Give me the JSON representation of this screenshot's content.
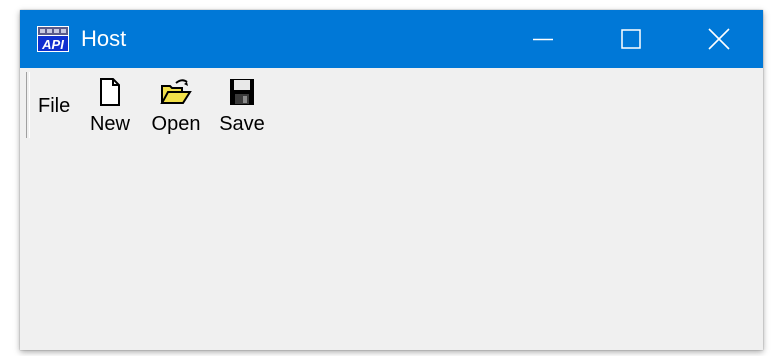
{
  "window": {
    "title": "Host",
    "icon": "api-app-icon",
    "icon_label": "API"
  },
  "caption_buttons": {
    "minimize": "minimize-icon",
    "maximize": "maximize-icon",
    "close": "close-icon"
  },
  "menu": {
    "file_label": "File"
  },
  "toolbar": {
    "items": [
      {
        "label": "New",
        "icon": "new-document-icon"
      },
      {
        "label": "Open",
        "icon": "open-folder-icon"
      },
      {
        "label": "Save",
        "icon": "save-disk-icon"
      }
    ]
  },
  "colors": {
    "titlebar": "#0078d7",
    "client": "#f0f0f0",
    "folder": "#f2e04a"
  }
}
